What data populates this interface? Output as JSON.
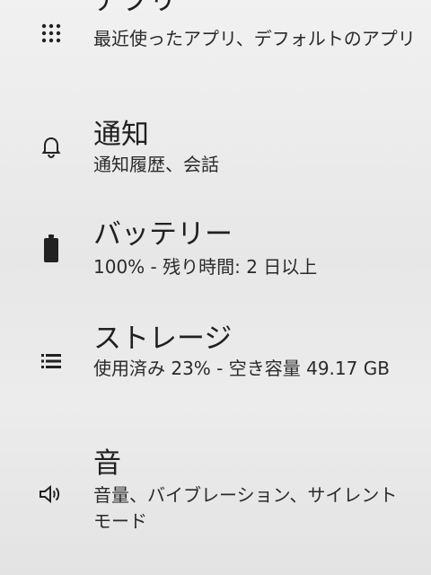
{
  "settings": {
    "items": [
      {
        "title": "アプリ",
        "subtitle": "最近使ったアプリ、デフォルトのアプリ",
        "icon": "apps-grid-icon"
      },
      {
        "title": "通知",
        "subtitle": "通知履歴、会話",
        "icon": "bell-icon"
      },
      {
        "title": "バッテリー",
        "subtitle": "100% - 残り時間: 2 日以上",
        "icon": "battery-icon"
      },
      {
        "title": "ストレージ",
        "subtitle": "使用済み 23% - 空き容量 49.17 GB",
        "icon": "storage-icon"
      },
      {
        "title": "音",
        "subtitle": "音量、バイブレーション、サイレント モード",
        "icon": "volume-icon"
      }
    ]
  },
  "colors": {
    "background": "#ececec",
    "text": "#202020",
    "icon": "#222222"
  }
}
